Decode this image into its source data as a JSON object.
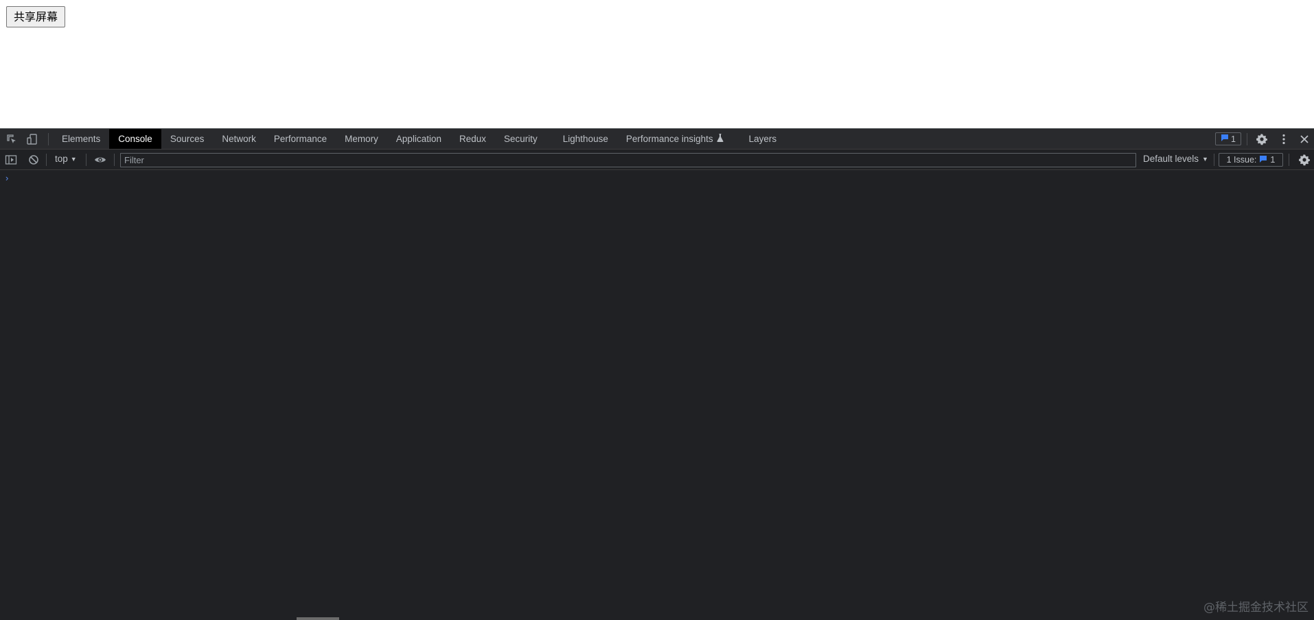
{
  "page": {
    "share_button_label": "共享屏幕"
  },
  "devtools": {
    "tabs": [
      {
        "label": "Elements",
        "active": false
      },
      {
        "label": "Console",
        "active": true
      },
      {
        "label": "Sources",
        "active": false
      },
      {
        "label": "Network",
        "active": false
      },
      {
        "label": "Performance",
        "active": false
      },
      {
        "label": "Memory",
        "active": false
      },
      {
        "label": "Application",
        "active": false
      },
      {
        "label": "Redux",
        "active": false
      },
      {
        "label": "Security",
        "active": false
      },
      {
        "label": "Lighthouse",
        "active": false
      },
      {
        "label": "Performance insights",
        "active": false,
        "icon": "flask-icon"
      },
      {
        "label": "Layers",
        "active": false
      }
    ],
    "issue_badge_count": "1",
    "toolbar_icons": [
      "inspect-element-icon",
      "device-toolbar-icon",
      "settings-gear-icon",
      "more-vertical-icon",
      "close-icon"
    ],
    "console_toolbar": {
      "context": "top",
      "filter_placeholder": "Filter",
      "levels": "Default levels",
      "issues_label": "1 Issue:",
      "issues_count": "1"
    },
    "console_icons": [
      "sidebar-toggle-icon",
      "clear-console-icon",
      "eye-icon",
      "console-settings-icon"
    ],
    "prompt_symbol": "›"
  },
  "watermark": "@稀土掘金技术社区",
  "colors": {
    "devtools_bg": "#202124",
    "tabbar_bg": "#292a2d",
    "active_tab_bg": "#000000",
    "text": "#bdc1c6",
    "accent_blue": "#3a7ff6"
  }
}
